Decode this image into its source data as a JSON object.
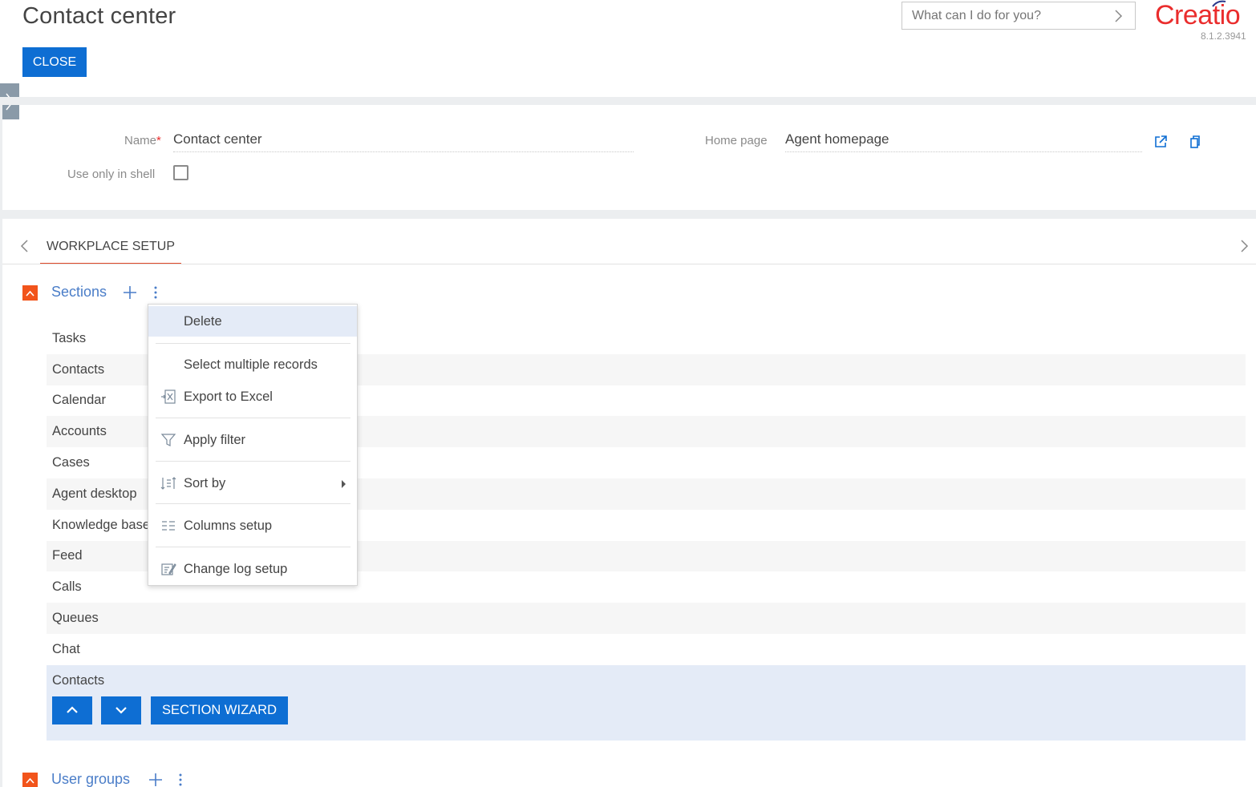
{
  "header": {
    "title": "Contact center",
    "close_label": "CLOSE",
    "search_placeholder": "What can I do for you?",
    "logo_text": "Creatio",
    "version": "8.1.2.3941",
    "brand_color": "#ea2d2d",
    "accent_color": "#0e6ed3"
  },
  "form": {
    "name_label": "Name",
    "name_required_mark": "*",
    "name_value": "Contact center",
    "home_page_label": "Home page",
    "home_page_value": "Agent homepage",
    "shell_label": "Use only in shell",
    "shell_checked": false
  },
  "tabs": [
    {
      "label": "WORKPLACE SETUP",
      "active": true
    }
  ],
  "sections_group": {
    "title": "Sections",
    "items": [
      {
        "label": "Tasks"
      },
      {
        "label": "Contacts"
      },
      {
        "label": "Calendar"
      },
      {
        "label": "Accounts"
      },
      {
        "label": "Cases"
      },
      {
        "label": "Agent desktop"
      },
      {
        "label": "Knowledge base"
      },
      {
        "label": "Feed"
      },
      {
        "label": "Calls"
      },
      {
        "label": "Queues"
      },
      {
        "label": "Chat"
      },
      {
        "label": "Contacts"
      }
    ],
    "selected_index": 11,
    "wizard_label": "SECTION WIZARD"
  },
  "user_groups": {
    "title": "User groups"
  },
  "menu": {
    "delete": "Delete",
    "select_multiple": "Select multiple records",
    "export_excel": "Export to Excel",
    "apply_filter": "Apply filter",
    "sort_by": "Sort by",
    "columns_setup": "Columns setup",
    "change_log": "Change log setup"
  }
}
